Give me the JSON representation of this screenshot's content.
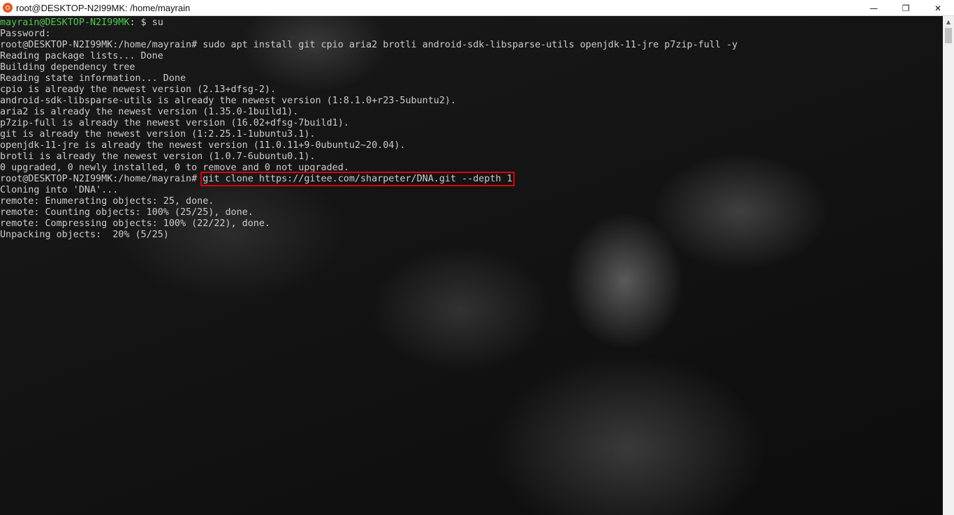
{
  "window": {
    "title": "root@DESKTOP-N2I99MK: /home/mayrain",
    "minimize_glyph": "—",
    "maximize_glyph": "❐",
    "close_glyph": "✕",
    "icon": "ubuntu-icon"
  },
  "terminal": {
    "lines": [
      {
        "prompt": "mayrain@DESKTOP-N2I99MK",
        "rest": ": $ su"
      },
      {
        "text": "Password:"
      },
      {
        "text": "root@DESKTOP-N2I99MK:/home/mayrain# sudo apt install git cpio aria2 brotli android-sdk-libsparse-utils openjdk-11-jre p7zip-full -y"
      },
      {
        "text": "Reading package lists... Done"
      },
      {
        "text": "Building dependency tree"
      },
      {
        "text": "Reading state information... Done"
      },
      {
        "text": "cpio is already the newest version (2.13+dfsg-2)."
      },
      {
        "text": "android-sdk-libsparse-utils is already the newest version (1:8.1.0+r23-5ubuntu2)."
      },
      {
        "text": "aria2 is already the newest version (1.35.0-1build1)."
      },
      {
        "text": "p7zip-full is already the newest version (16.02+dfsg-7build1)."
      },
      {
        "text": "git is already the newest version (1:2.25.1-1ubuntu3.1)."
      },
      {
        "text": "openjdk-11-jre is already the newest version (11.0.11+9-0ubuntu2~20.04)."
      },
      {
        "text": "brotli is already the newest version (1.0.7-6ubuntu0.1)."
      },
      {
        "text": "0 upgraded, 0 newly installed, 0 to remove and 0 not upgraded."
      },
      {
        "prefix": "root@DESKTOP-N2I99MK:/home/mayrain# ",
        "command": "git clone https://gitee.com/sharpeter/DNA.git --depth 1"
      },
      {
        "text": "Cloning into 'DNA'..."
      },
      {
        "text": "remote: Enumerating objects: 25, done."
      },
      {
        "text": "remote: Counting objects: 100% (25/25), done."
      },
      {
        "text": "remote: Compressing objects: 100% (22/22), done."
      },
      {
        "text": "Unpacking objects:  20% (5/25)"
      }
    ]
  },
  "colors": {
    "prompt_green": "#4ec94e",
    "text": "#cccccc",
    "highlight_box": "#e00000"
  }
}
